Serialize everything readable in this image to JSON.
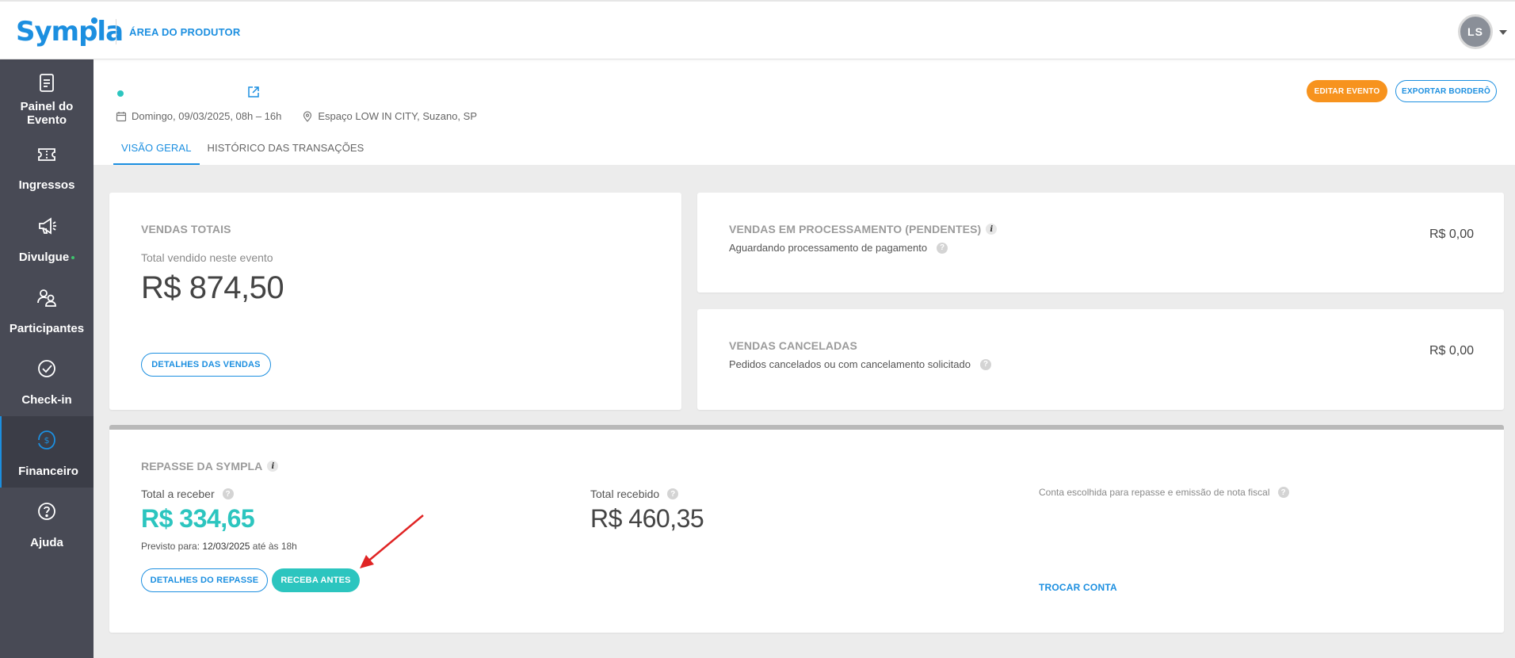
{
  "header": {
    "logo_text": "Sympla",
    "area_label": "ÁREA DO PRODUTOR",
    "avatar_initials": "LS"
  },
  "sidebar": {
    "items": [
      {
        "label": "Painel do Evento",
        "icon": "dashboard-icon"
      },
      {
        "label": "Ingressos",
        "icon": "ticket-icon"
      },
      {
        "label": "Divulgue",
        "icon": "megaphone-icon"
      },
      {
        "label": "Participantes",
        "icon": "people-icon"
      },
      {
        "label": "Check-in",
        "icon": "check-circle-icon"
      },
      {
        "label": "Financeiro",
        "icon": "money-icon",
        "active": true
      },
      {
        "label": "Ajuda",
        "icon": "help-icon"
      }
    ]
  },
  "event": {
    "date": "Domingo, 09/03/2025, 08h – 16h",
    "location": "Espaço LOW IN CITY, Suzano, SP",
    "edit_button": "EDITAR EVENTO",
    "export_button": "EXPORTAR BORDERÔ",
    "tabs": [
      {
        "label": "VISÃO GERAL",
        "active": true
      },
      {
        "label": "HISTÓRICO DAS TRANSAÇÕES",
        "active": false
      }
    ]
  },
  "vendas_totais": {
    "title": "VENDAS TOTAIS",
    "subtitle": "Total vendido neste evento",
    "amount": "R$ 874,50",
    "button": "DETALHES DAS VENDAS"
  },
  "vendas_processamento": {
    "title": "VENDAS EM PROCESSAMENTO (PENDENTES)",
    "subtitle": "Aguardando processamento de pagamento",
    "amount": "R$ 0,00"
  },
  "vendas_canceladas": {
    "title": "VENDAS CANCELADAS",
    "subtitle": "Pedidos cancelados ou com cancelamento solicitado",
    "amount": "R$ 0,00"
  },
  "repasse": {
    "title": "REPASSE DA SYMPLA",
    "a_receber_label": "Total a receber",
    "a_receber_amount": "R$ 334,65",
    "previsto_label": "Previsto para:",
    "previsto_value": "12/03/2025",
    "previsto_suffix": "até às 18h",
    "recebido_label": "Total recebido",
    "recebido_amount": "R$ 460,35",
    "conta_label": "Conta escolhida para repasse e emissão de nota fiscal",
    "detalhes_button": "DETALHES DO REPASSE",
    "receba_button": "RECEBA ANTES",
    "trocar_link": "TROCAR CONTA"
  },
  "colors": {
    "brand_blue": "#1c8fe0",
    "teal": "#2cc5bf",
    "orange": "#f7931e",
    "sidebar": "#484a55",
    "arrow_red": "#e02424"
  }
}
